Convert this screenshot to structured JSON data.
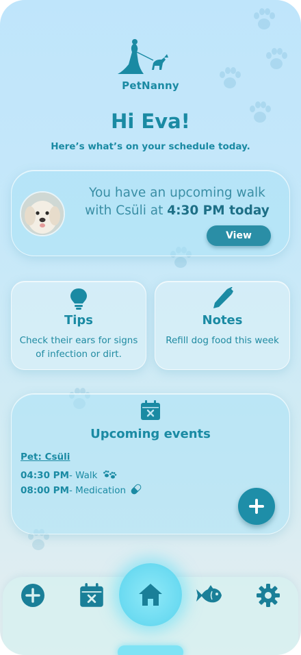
{
  "app": {
    "name": "PetNanny"
  },
  "header": {
    "greeting": "Hi Eva!",
    "subtitle": "Here’s what’s on your schedule today."
  },
  "walk_card": {
    "text_prefix": "You have an upcoming walk with Csüli at ",
    "time_bold": "4:30 PM today",
    "view_label": "View"
  },
  "tips": {
    "title": "Tips",
    "body": "Check their ears for signs of infection or dirt.",
    "icon": "lightbulb-icon"
  },
  "notes": {
    "title": "Notes",
    "body": "Refill dog food this week",
    "icon": "pen-icon"
  },
  "events": {
    "title": "Upcoming events",
    "pet_label": "Pet: Csüli",
    "items": [
      {
        "time": "04:30 PM",
        "label": "- Walk",
        "icon": "paw-icon"
      },
      {
        "time": "08:00 PM",
        "label": "- Medication",
        "icon": "pill-icon"
      }
    ]
  },
  "nav": {
    "items": [
      "add-icon",
      "calendar-icon",
      "home-icon",
      "fish-icon",
      "settings-icon"
    ],
    "active": "home-icon"
  },
  "colors": {
    "primary": "#1a8aa3",
    "button": "#2a8ea6",
    "glow": "#6fdcf2"
  }
}
